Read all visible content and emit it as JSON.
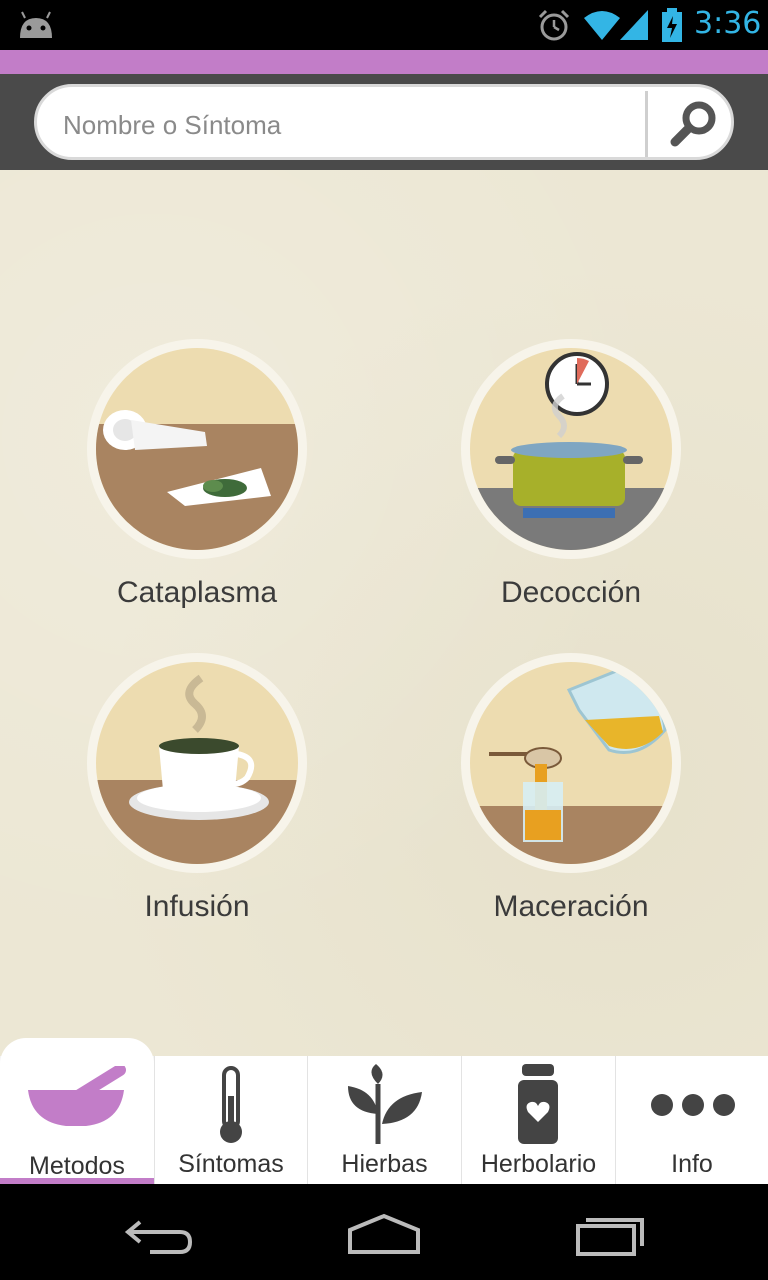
{
  "status": {
    "time": "3:36"
  },
  "search": {
    "placeholder": "Nombre o Síntoma"
  },
  "methods": [
    {
      "label": "Cataplasma"
    },
    {
      "label": "Decocción"
    },
    {
      "label": "Infusión"
    },
    {
      "label": "Maceración"
    }
  ],
  "tabs": [
    {
      "label": "Metodos",
      "icon": "mortar-pestle-icon",
      "active": true
    },
    {
      "label": "Síntomas",
      "icon": "thermometer-icon"
    },
    {
      "label": "Hierbas",
      "icon": "leaf-icon"
    },
    {
      "label": "Herbolario",
      "icon": "jar-heart-icon"
    },
    {
      "label": "Info",
      "icon": "more-dots-icon"
    }
  ],
  "colors": {
    "accent": "#c27dc8",
    "toolbar": "#4a4a4a",
    "background": "#ece7d4",
    "status_blue": "#33b5e5"
  }
}
